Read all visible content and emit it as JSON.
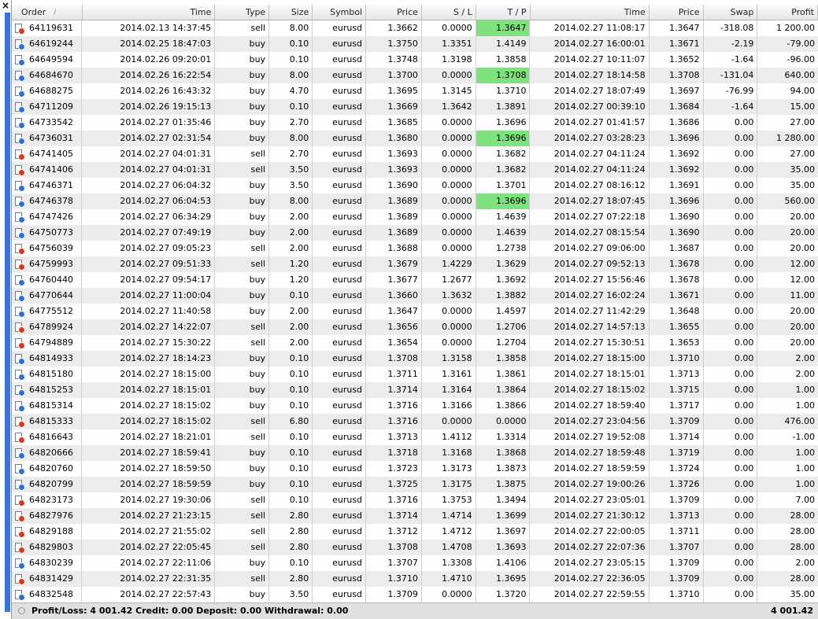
{
  "window": {
    "close_glyph": "×"
  },
  "columns": [
    "Order",
    "Time",
    "Type",
    "Size",
    "Symbol",
    "Price",
    "S / L",
    "T / P",
    "Time",
    "Price",
    "Swap",
    "Profit"
  ],
  "sort_indicator": "/",
  "rows": [
    [
      "64119631",
      "2014.02.13 14:37:45",
      "sell",
      "8.00",
      "eurusd",
      "1.3662",
      "0.0000",
      "1.3647",
      "2014.02.27 11:08:17",
      "1.3647",
      "-318.08",
      "1 200.00",
      true
    ],
    [
      "64619244",
      "2014.02.25 18:47:03",
      "buy",
      "0.10",
      "eurusd",
      "1.3750",
      "1.3351",
      "1.4149",
      "2014.02.27 16:00:01",
      "1.3671",
      "-2.19",
      "-79.00",
      false
    ],
    [
      "64649594",
      "2014.02.26 09:20:01",
      "buy",
      "0.10",
      "eurusd",
      "1.3748",
      "1.3198",
      "1.3858",
      "2014.02.27 10:11:07",
      "1.3652",
      "-1.64",
      "-96.00",
      false
    ],
    [
      "64684670",
      "2014.02.26 16:22:54",
      "buy",
      "8.00",
      "eurusd",
      "1.3700",
      "0.0000",
      "1.3708",
      "2014.02.27 18:14:58",
      "1.3708",
      "-131.04",
      "640.00",
      true
    ],
    [
      "64688275",
      "2014.02.26 16:43:32",
      "buy",
      "4.70",
      "eurusd",
      "1.3695",
      "1.3145",
      "1.3710",
      "2014.02.27 18:07:49",
      "1.3697",
      "-76.99",
      "94.00",
      false
    ],
    [
      "64711209",
      "2014.02.26 19:15:13",
      "buy",
      "0.10",
      "eurusd",
      "1.3669",
      "1.3642",
      "1.3891",
      "2014.02.27 00:39:10",
      "1.3684",
      "-1.64",
      "15.00",
      false
    ],
    [
      "64733542",
      "2014.02.27 01:35:46",
      "buy",
      "2.70",
      "eurusd",
      "1.3685",
      "0.0000",
      "1.3696",
      "2014.02.27 01:41:57",
      "1.3686",
      "0.00",
      "27.00",
      false
    ],
    [
      "64736031",
      "2014.02.27 02:31:54",
      "buy",
      "8.00",
      "eurusd",
      "1.3680",
      "0.0000",
      "1.3696",
      "2014.02.27 03:28:23",
      "1.3696",
      "0.00",
      "1 280.00",
      true
    ],
    [
      "64741405",
      "2014.02.27 04:01:31",
      "sell",
      "2.70",
      "eurusd",
      "1.3693",
      "0.0000",
      "1.3682",
      "2014.02.27 04:11:24",
      "1.3692",
      "0.00",
      "27.00",
      false
    ],
    [
      "64741406",
      "2014.02.27 04:01:31",
      "sell",
      "3.50",
      "eurusd",
      "1.3693",
      "0.0000",
      "1.3682",
      "2014.02.27 04:11:24",
      "1.3692",
      "0.00",
      "35.00",
      false
    ],
    [
      "64746371",
      "2014.02.27 06:04:32",
      "buy",
      "3.50",
      "eurusd",
      "1.3690",
      "0.0000",
      "1.3701",
      "2014.02.27 08:16:12",
      "1.3691",
      "0.00",
      "35.00",
      false
    ],
    [
      "64746378",
      "2014.02.27 06:04:53",
      "buy",
      "8.00",
      "eurusd",
      "1.3689",
      "0.0000",
      "1.3696",
      "2014.02.27 18:07:45",
      "1.3696",
      "0.00",
      "560.00",
      true
    ],
    [
      "64747426",
      "2014.02.27 06:34:29",
      "buy",
      "2.00",
      "eurusd",
      "1.3689",
      "0.0000",
      "1.4639",
      "2014.02.27 07:22:18",
      "1.3690",
      "0.00",
      "20.00",
      false
    ],
    [
      "64750773",
      "2014.02.27 07:49:19",
      "buy",
      "2.00",
      "eurusd",
      "1.3689",
      "0.0000",
      "1.4639",
      "2014.02.27 08:15:54",
      "1.3690",
      "0.00",
      "20.00",
      false
    ],
    [
      "64756039",
      "2014.02.27 09:05:23",
      "sell",
      "2.00",
      "eurusd",
      "1.3688",
      "0.0000",
      "1.2738",
      "2014.02.27 09:06:00",
      "1.3687",
      "0.00",
      "20.00",
      false
    ],
    [
      "64759993",
      "2014.02.27 09:51:33",
      "sell",
      "1.20",
      "eurusd",
      "1.3679",
      "1.4229",
      "1.3629",
      "2014.02.27 09:52:13",
      "1.3678",
      "0.00",
      "12.00",
      false
    ],
    [
      "64760440",
      "2014.02.27 09:54:17",
      "buy",
      "1.20",
      "eurusd",
      "1.3677",
      "1.2677",
      "1.3692",
      "2014.02.27 15:56:46",
      "1.3678",
      "0.00",
      "12.00",
      false
    ],
    [
      "64770644",
      "2014.02.27 11:00:04",
      "buy",
      "0.10",
      "eurusd",
      "1.3660",
      "1.3632",
      "1.3882",
      "2014.02.27 16:02:24",
      "1.3671",
      "0.00",
      "11.00",
      false
    ],
    [
      "64775512",
      "2014.02.27 11:40:58",
      "buy",
      "2.00",
      "eurusd",
      "1.3647",
      "0.0000",
      "1.4597",
      "2014.02.27 11:42:29",
      "1.3648",
      "0.00",
      "20.00",
      false
    ],
    [
      "64789924",
      "2014.02.27 14:22:07",
      "sell",
      "2.00",
      "eurusd",
      "1.3656",
      "0.0000",
      "1.2706",
      "2014.02.27 14:57:13",
      "1.3655",
      "0.00",
      "20.00",
      false
    ],
    [
      "64794889",
      "2014.02.27 15:30:22",
      "sell",
      "2.00",
      "eurusd",
      "1.3654",
      "0.0000",
      "1.2704",
      "2014.02.27 15:30:51",
      "1.3653",
      "0.00",
      "20.00",
      false
    ],
    [
      "64814933",
      "2014.02.27 18:14:23",
      "buy",
      "0.10",
      "eurusd",
      "1.3708",
      "1.3158",
      "1.3858",
      "2014.02.27 18:15:00",
      "1.3710",
      "0.00",
      "2.00",
      false
    ],
    [
      "64815180",
      "2014.02.27 18:15:00",
      "buy",
      "0.10",
      "eurusd",
      "1.3711",
      "1.3161",
      "1.3861",
      "2014.02.27 18:15:01",
      "1.3713",
      "0.00",
      "2.00",
      false
    ],
    [
      "64815253",
      "2014.02.27 18:15:01",
      "buy",
      "0.10",
      "eurusd",
      "1.3714",
      "1.3164",
      "1.3864",
      "2014.02.27 18:15:02",
      "1.3715",
      "0.00",
      "1.00",
      false
    ],
    [
      "64815314",
      "2014.02.27 18:15:02",
      "buy",
      "0.10",
      "eurusd",
      "1.3716",
      "1.3166",
      "1.3866",
      "2014.02.27 18:59:40",
      "1.3717",
      "0.00",
      "1.00",
      false
    ],
    [
      "64815333",
      "2014.02.27 18:15:02",
      "sell",
      "6.80",
      "eurusd",
      "1.3716",
      "0.0000",
      "0.0000",
      "2014.02.27 23:04:56",
      "1.3709",
      "0.00",
      "476.00",
      false
    ],
    [
      "64816643",
      "2014.02.27 18:21:01",
      "sell",
      "0.10",
      "eurusd",
      "1.3713",
      "1.4112",
      "1.3314",
      "2014.02.27 19:52:08",
      "1.3714",
      "0.00",
      "-1.00",
      false
    ],
    [
      "64820666",
      "2014.02.27 18:59:41",
      "buy",
      "0.10",
      "eurusd",
      "1.3718",
      "1.3168",
      "1.3868",
      "2014.02.27 18:59:48",
      "1.3719",
      "0.00",
      "1.00",
      false
    ],
    [
      "64820760",
      "2014.02.27 18:59:50",
      "buy",
      "0.10",
      "eurusd",
      "1.3723",
      "1.3173",
      "1.3873",
      "2014.02.27 18:59:59",
      "1.3724",
      "0.00",
      "1.00",
      false
    ],
    [
      "64820799",
      "2014.02.27 18:59:59",
      "buy",
      "0.10",
      "eurusd",
      "1.3725",
      "1.3175",
      "1.3875",
      "2014.02.27 19:00:26",
      "1.3726",
      "0.00",
      "1.00",
      false
    ],
    [
      "64823173",
      "2014.02.27 19:30:06",
      "sell",
      "0.10",
      "eurusd",
      "1.3716",
      "1.3753",
      "1.3494",
      "2014.02.27 23:05:01",
      "1.3709",
      "0.00",
      "7.00",
      false
    ],
    [
      "64827976",
      "2014.02.27 21:23:15",
      "sell",
      "2.80",
      "eurusd",
      "1.3714",
      "1.4714",
      "1.3699",
      "2014.02.27 21:30:12",
      "1.3713",
      "0.00",
      "28.00",
      false
    ],
    [
      "64829188",
      "2014.02.27 21:55:02",
      "sell",
      "2.80",
      "eurusd",
      "1.3712",
      "1.4712",
      "1.3697",
      "2014.02.27 22:00:05",
      "1.3711",
      "0.00",
      "28.00",
      false
    ],
    [
      "64829803",
      "2014.02.27 22:05:45",
      "sell",
      "2.80",
      "eurusd",
      "1.3708",
      "1.4708",
      "1.3693",
      "2014.02.27 22:07:36",
      "1.3707",
      "0.00",
      "28.00",
      false
    ],
    [
      "64830239",
      "2014.02.27 22:11:06",
      "buy",
      "0.10",
      "eurusd",
      "1.3707",
      "1.3308",
      "1.4106",
      "2014.02.27 23:05:15",
      "1.3709",
      "0.00",
      "2.00",
      false
    ],
    [
      "64831429",
      "2014.02.27 22:31:35",
      "sell",
      "2.80",
      "eurusd",
      "1.3710",
      "1.4710",
      "1.3695",
      "2014.02.27 22:36:05",
      "1.3709",
      "0.00",
      "28.00",
      false
    ],
    [
      "64832548",
      "2014.02.27 22:57:43",
      "buy",
      "3.50",
      "eurusd",
      "1.3709",
      "0.0000",
      "1.3720",
      "2014.02.27 22:59:55",
      "1.3710",
      "0.00",
      "35.00",
      false
    ]
  ],
  "colors": {
    "tp_highlight": "#7ee27e",
    "sell_dot": "#d43a1c",
    "buy_dot": "#2f6fd6",
    "side_stripe": "#3b72d6"
  },
  "footer": {
    "summary": "Profit/Loss: 4 001.42  Credit: 0.00  Deposit: 0.00  Withdrawal: 0.00",
    "total": "4 001.42"
  }
}
